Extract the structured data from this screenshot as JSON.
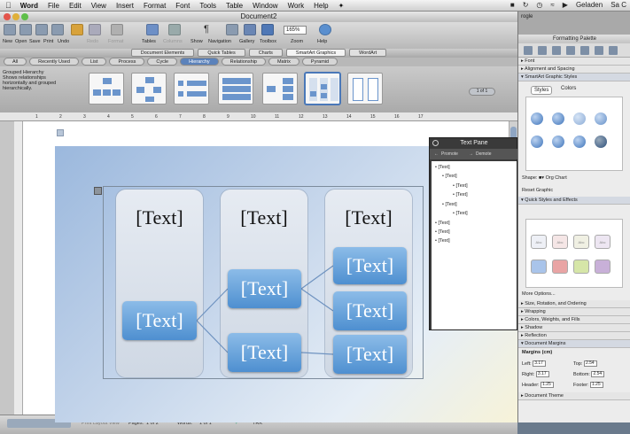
{
  "menubar": {
    "app": "Word",
    "items": [
      "File",
      "Edit",
      "View",
      "Insert",
      "Format",
      "Font",
      "Tools",
      "Table",
      "Window",
      "Work",
      "Help"
    ],
    "right": {
      "user": "Geladen",
      "truncated_extra": "Sa C"
    }
  },
  "window": {
    "title": "Document2"
  },
  "toolbar": {
    "labels": [
      "New",
      "Open",
      "Save",
      "Print",
      "Undo",
      "Redo",
      "Format",
      "Tables",
      "Columns",
      "Show",
      "Navigation",
      "Gallery",
      "Toolbox",
      "Zoom",
      "Help"
    ],
    "zoom": "165%"
  },
  "element_gallery": {
    "tabs": [
      "Document Elements",
      "Quick Tables",
      "Charts",
      "SmartArt Graphics",
      "WordArt"
    ],
    "selected": "SmartArt Graphics"
  },
  "category_tabs": {
    "items": [
      "All",
      "Recently Used",
      "List",
      "Process",
      "Cycle",
      "Hierarchy",
      "Relationship",
      "Matrix",
      "Pyramid"
    ],
    "selected": "Hierarchy"
  },
  "gallery": {
    "description": "Grouped Hierarchy\nShows relationships horizontally and grouped hierarchically.",
    "nav": "1 of 1"
  },
  "ruler": {
    "marks": [
      "1",
      "2",
      "3",
      "4",
      "5",
      "6",
      "7",
      "8",
      "9",
      "10",
      "11",
      "12",
      "13",
      "14",
      "15",
      "16",
      "17"
    ]
  },
  "diagram": {
    "columns": [
      "[Text]",
      "[Text]",
      "[Text]"
    ],
    "nodes": {
      "level1": "[Text]",
      "level2": [
        "[Text]",
        "[Text]"
      ],
      "level3": [
        "[Text]",
        "[Text]",
        "[Text]"
      ]
    }
  },
  "text_pane": {
    "title": "Text Pane",
    "tools": [
      "Promote",
      "Demote"
    ],
    "items": [
      "[Text]",
      "[Text]",
      "[Text]",
      "[Text]",
      "[Text]",
      "[Text]",
      "[Text]",
      "[Text]",
      "[Text]"
    ]
  },
  "statusbar": {
    "view": "Print Layout View",
    "pages_label": "Pages:",
    "pages": "1 of 2",
    "words_label": "Words:",
    "words": "1 of 1",
    "trk": "TRK"
  },
  "palette": {
    "title": "Formatting Palette",
    "top_label": "rogle",
    "sections": {
      "font": "Font",
      "align": "Alignment and Spacing",
      "smartart": "SmartArt Graphic Styles",
      "styles_tab": "Styles",
      "colors_tab": "Colors",
      "shape_label": "Shape:",
      "shape_value": "Org Chart",
      "reset": "Reset Graphic",
      "quick": "Quick Styles and Effects",
      "swatch_label": "Abc",
      "more": "More Options...",
      "size": "Size, Rotation, and Ordering",
      "wrapping": "Wrapping",
      "colors_weights": "Colors, Weights, and Fills",
      "shadow": "Shadow",
      "reflection": "Reflection",
      "doc_margins": "Document Margins",
      "margins_unit": "Margins (cm)",
      "left_label": "Left:",
      "left": "3.17",
      "top_label": "Top:",
      "top": "2.54",
      "right_label": "Right:",
      "right": "3.17",
      "bottom_label": "Bottom:",
      "bottom": "2.54",
      "header_label": "Header:",
      "header": "1.25",
      "footer_label": "Footer:",
      "footer": "1.25",
      "theme": "Document Theme"
    }
  }
}
